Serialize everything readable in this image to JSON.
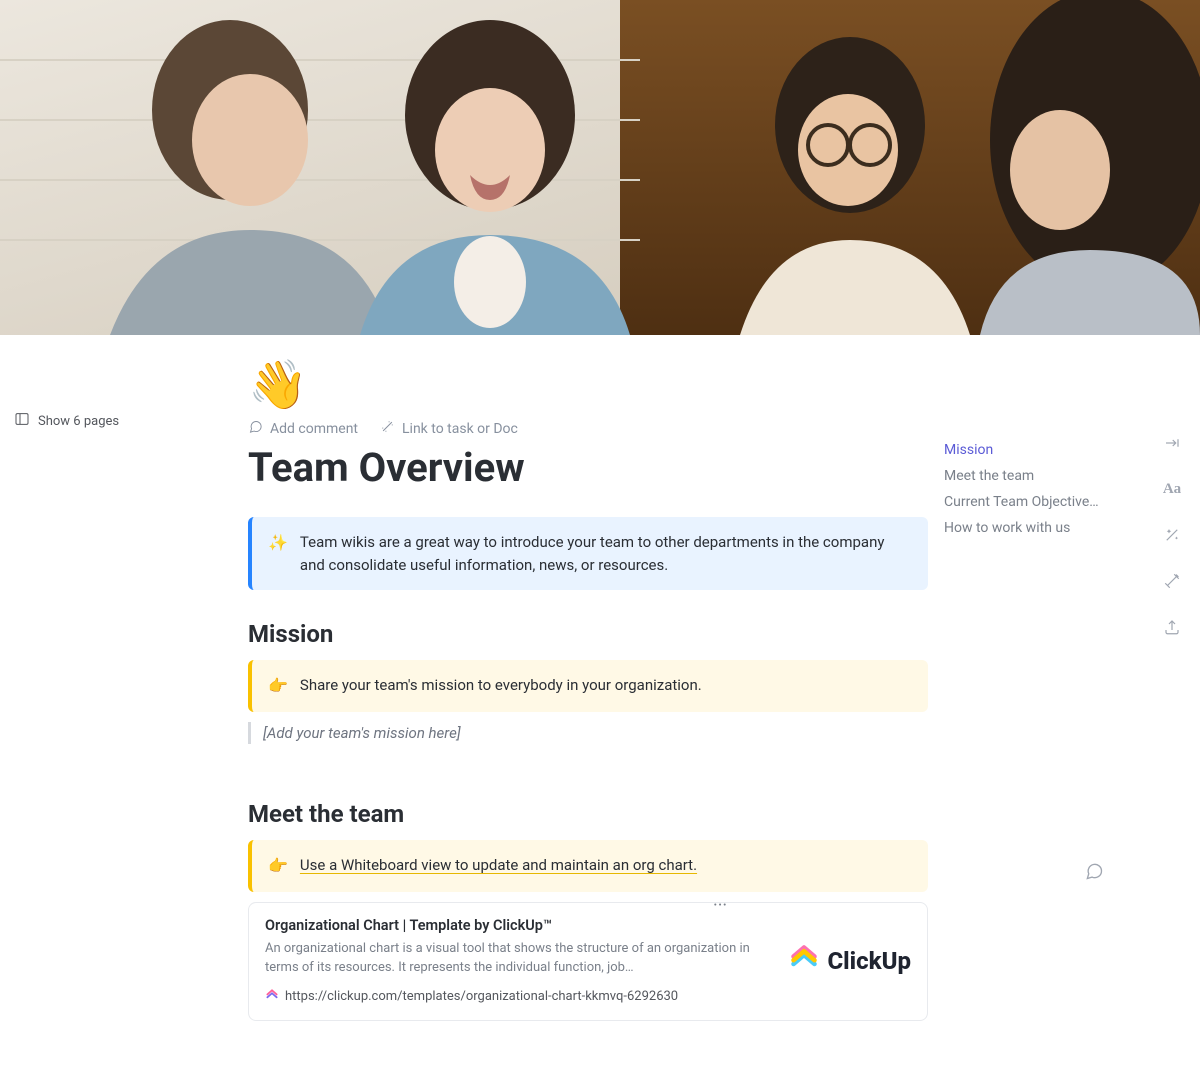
{
  "sidebar": {
    "show_pages_label": "Show 6 pages"
  },
  "page": {
    "emoji": "👋",
    "title": "Team Overview"
  },
  "actions": {
    "add_comment": "Add comment",
    "link_task": "Link to task or Doc"
  },
  "intro_callout": {
    "emoji": "✨",
    "text": "Team wikis are a great way to introduce your team to other departments in the company and consolidate useful information, news, or resources."
  },
  "sections": {
    "mission": {
      "heading": "Mission",
      "callout_emoji": "👉",
      "callout_text": "Share your team's mission to everybody in your organization.",
      "placeholder": "[Add your team's mission here]"
    },
    "meet_team": {
      "heading": "Meet the team",
      "callout_emoji": "👉",
      "callout_text": "Use a Whiteboard view to update and maintain an org chart."
    }
  },
  "bookmark": {
    "title": "Organizational Chart | Template by ClickUp™",
    "description": "An organizational chart is a visual tool that shows the structure of an organization in terms of its resources. It represents the individual function, job…",
    "url": "https://clickup.com/templates/organizational-chart-kkmvq-6292630",
    "brand": "ClickUp"
  },
  "outline": [
    {
      "label": "Mission",
      "active": true
    },
    {
      "label": "Meet the team",
      "active": false
    },
    {
      "label": "Current Team Objective…",
      "active": false
    },
    {
      "label": "How to work with us",
      "active": false
    }
  ],
  "rail": {
    "collapse": "collapse-icon",
    "typography": "Aa",
    "ai": "ai-icon",
    "templates": "template-icon",
    "export": "export-icon"
  }
}
